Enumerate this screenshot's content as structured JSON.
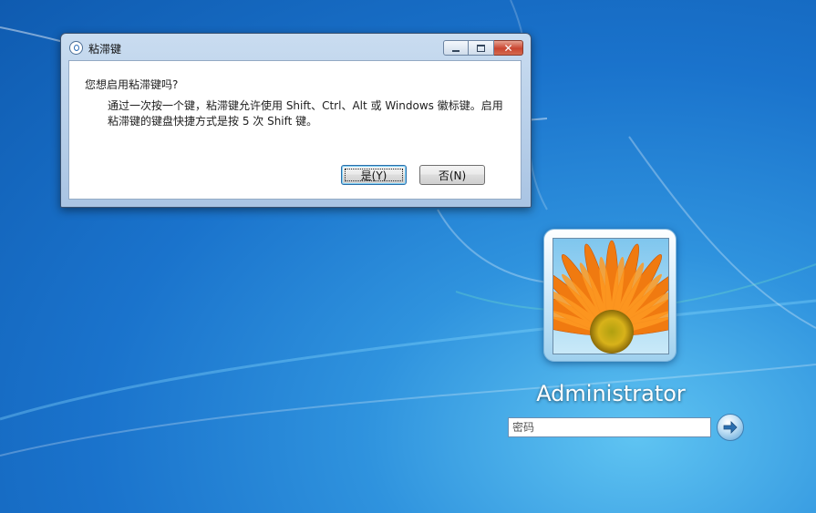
{
  "dialog": {
    "title": "粘滞键",
    "question": "您想启用粘滞键吗?",
    "detail": "通过一次按一个键，粘滞键允许使用 Shift、Ctrl、Alt 或 Windows 徽标键。启用粘滞键的键盘快捷方式是按 5 次 Shift 键。",
    "yes_label": "是(Y)",
    "no_label": "否(N)",
    "close_glyph": "✕"
  },
  "logon": {
    "username": "Administrator",
    "password_placeholder": "密码",
    "submit_icon": "arrow-right-icon"
  },
  "colors": {
    "desktop_blue": "#1a73cc",
    "close_red": "#c94530",
    "flower_orange": "#f07a10"
  }
}
